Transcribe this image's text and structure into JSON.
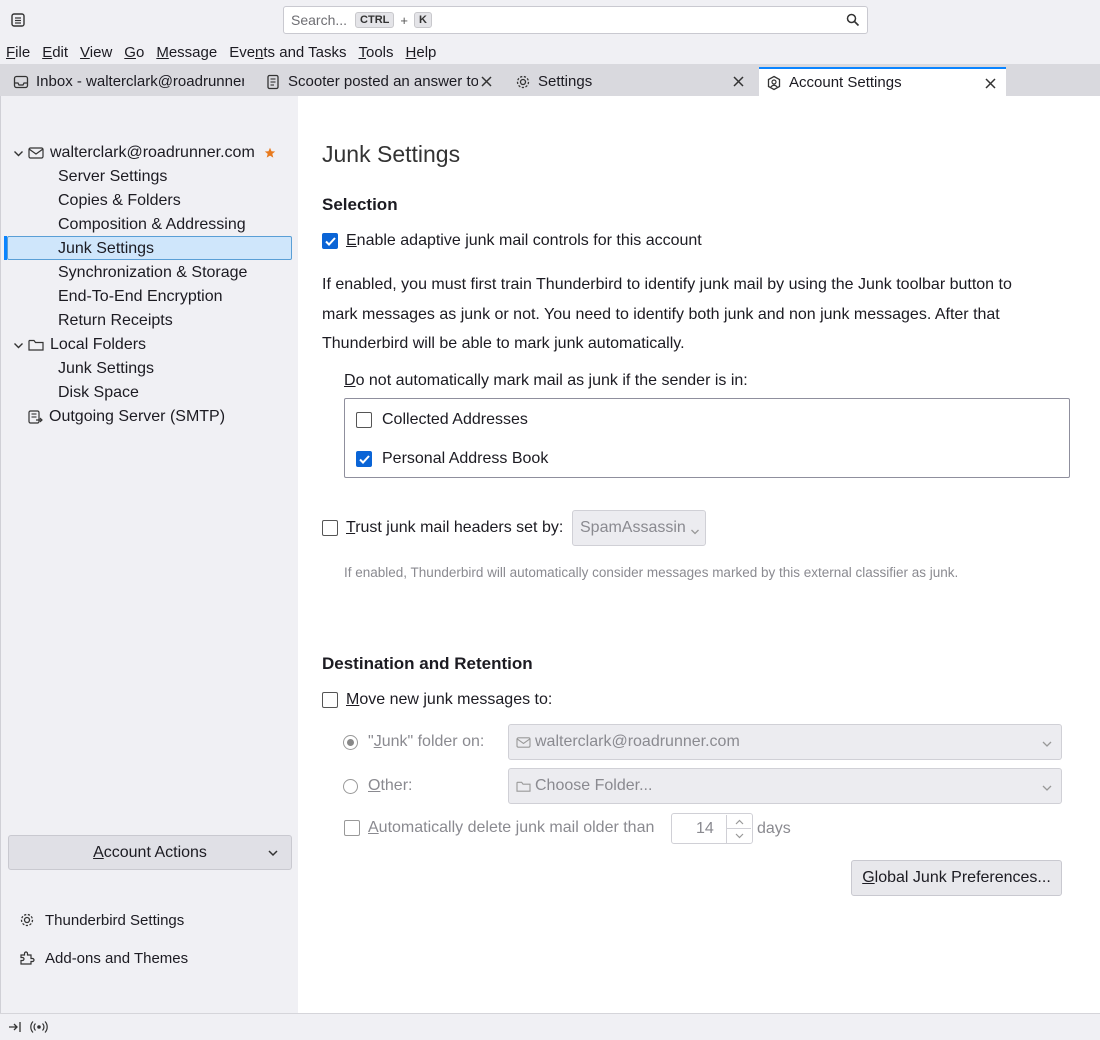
{
  "search": {
    "placeholder": "Search...",
    "shortcut_key1": "CTRL",
    "shortcut_plus": "+",
    "shortcut_key2": "K"
  },
  "menubar": {
    "items": [
      {
        "pre": "",
        "u": "F",
        "post": "ile"
      },
      {
        "pre": "",
        "u": "E",
        "post": "dit"
      },
      {
        "pre": "",
        "u": "V",
        "post": "iew"
      },
      {
        "pre": "",
        "u": "G",
        "post": "o"
      },
      {
        "pre": "",
        "u": "M",
        "post": "essage"
      },
      {
        "pre": "Eve",
        "u": "n",
        "post": "ts and Tasks"
      },
      {
        "pre": "",
        "u": "T",
        "post": "ools"
      },
      {
        "pre": "",
        "u": "H",
        "post": "elp"
      }
    ]
  },
  "tabs": [
    {
      "label": "Inbox - walterclark@roadrunner.com",
      "icon": "inbox-icon"
    },
    {
      "label": "Scooter posted an answer to",
      "icon": "document-icon"
    },
    {
      "label": "Settings",
      "icon": "gear-icon"
    },
    {
      "label": "Account Settings",
      "icon": "account-settings-icon"
    }
  ],
  "sidebar": {
    "account": "walterclark@roadrunner.com",
    "account_items": [
      "Server Settings",
      "Copies & Folders",
      "Composition & Addressing",
      "Junk Settings",
      "Synchronization & Storage",
      "End-To-End Encryption",
      "Return Receipts"
    ],
    "local_folders": "Local Folders",
    "local_items": [
      "Junk Settings",
      "Disk Space"
    ],
    "outgoing": "Outgoing Server (SMTP)",
    "account_actions_pre": "",
    "account_actions_u": "A",
    "account_actions_post": "ccount Actions",
    "thunderbird_settings": "Thunderbird Settings",
    "addons": "Add-ons and Themes"
  },
  "main": {
    "title": "Junk Settings",
    "selection_heading": "Selection",
    "enable_adaptive": {
      "pre": "",
      "u": "E",
      "post": "nable adaptive junk mail controls for this account",
      "checked": true
    },
    "description_lines": [
      "If enabled, you must first train Thunderbird to identify junk mail by using the Junk toolbar button to",
      "mark messages as junk or not. You need to identify both junk and non junk messages. After that",
      "Thunderbird will be able to mark junk automatically."
    ],
    "whitelist_label": {
      "pre": "",
      "u": "D",
      "post": "o not automatically mark mail as junk if the sender is in:"
    },
    "address_books": [
      {
        "label": "Collected Addresses",
        "checked": false
      },
      {
        "label": "Personal Address Book",
        "checked": true
      }
    ],
    "trust_headers": {
      "pre": "",
      "u": "T",
      "post": "rust junk mail headers set by:",
      "checked": false
    },
    "trust_select_value": "SpamAssassin",
    "trust_note": "If enabled, Thunderbird will automatically consider messages marked by this external classifier as junk.",
    "destination_heading": "Destination and Retention",
    "move_junk": {
      "pre": "",
      "u": "M",
      "post": "ove new junk messages to:",
      "checked": false
    },
    "junk_folder_on": {
      "pre": "\"",
      "u": "J",
      "post": "unk\" folder on:",
      "selected": true
    },
    "junk_folder_account": "walterclark@roadrunner.com",
    "other": {
      "pre": "",
      "u": "O",
      "post": "ther:",
      "selected": false
    },
    "choose_folder": "Choose Folder...",
    "auto_delete": {
      "pre": "",
      "u": "A",
      "post": "utomatically delete junk mail older than",
      "checked": false
    },
    "days_value": "14",
    "days_label": "days",
    "global_prefs": {
      "pre": "",
      "u": "G",
      "post": "lobal Junk Preferences..."
    }
  },
  "colors": {
    "accent": "#0a84ff",
    "checkbox_checked": "#0a64d6",
    "sidebar_bg": "#f0f0f4",
    "selection_bg": "#cfe6fb",
    "tabbar_bg": "#d9d9de",
    "star": "#e87a1e"
  },
  "icons": [
    "app-menu-icon",
    "search-icon",
    "inbox-icon",
    "document-icon",
    "gear-icon",
    "account-settings-icon",
    "close-icon",
    "chevron-down-icon",
    "envelope-account-icon",
    "star-icon",
    "folder-icon",
    "outgoing-server-icon",
    "puzzle-icon",
    "collapse-sidebar-icon",
    "online-status-icon"
  ]
}
